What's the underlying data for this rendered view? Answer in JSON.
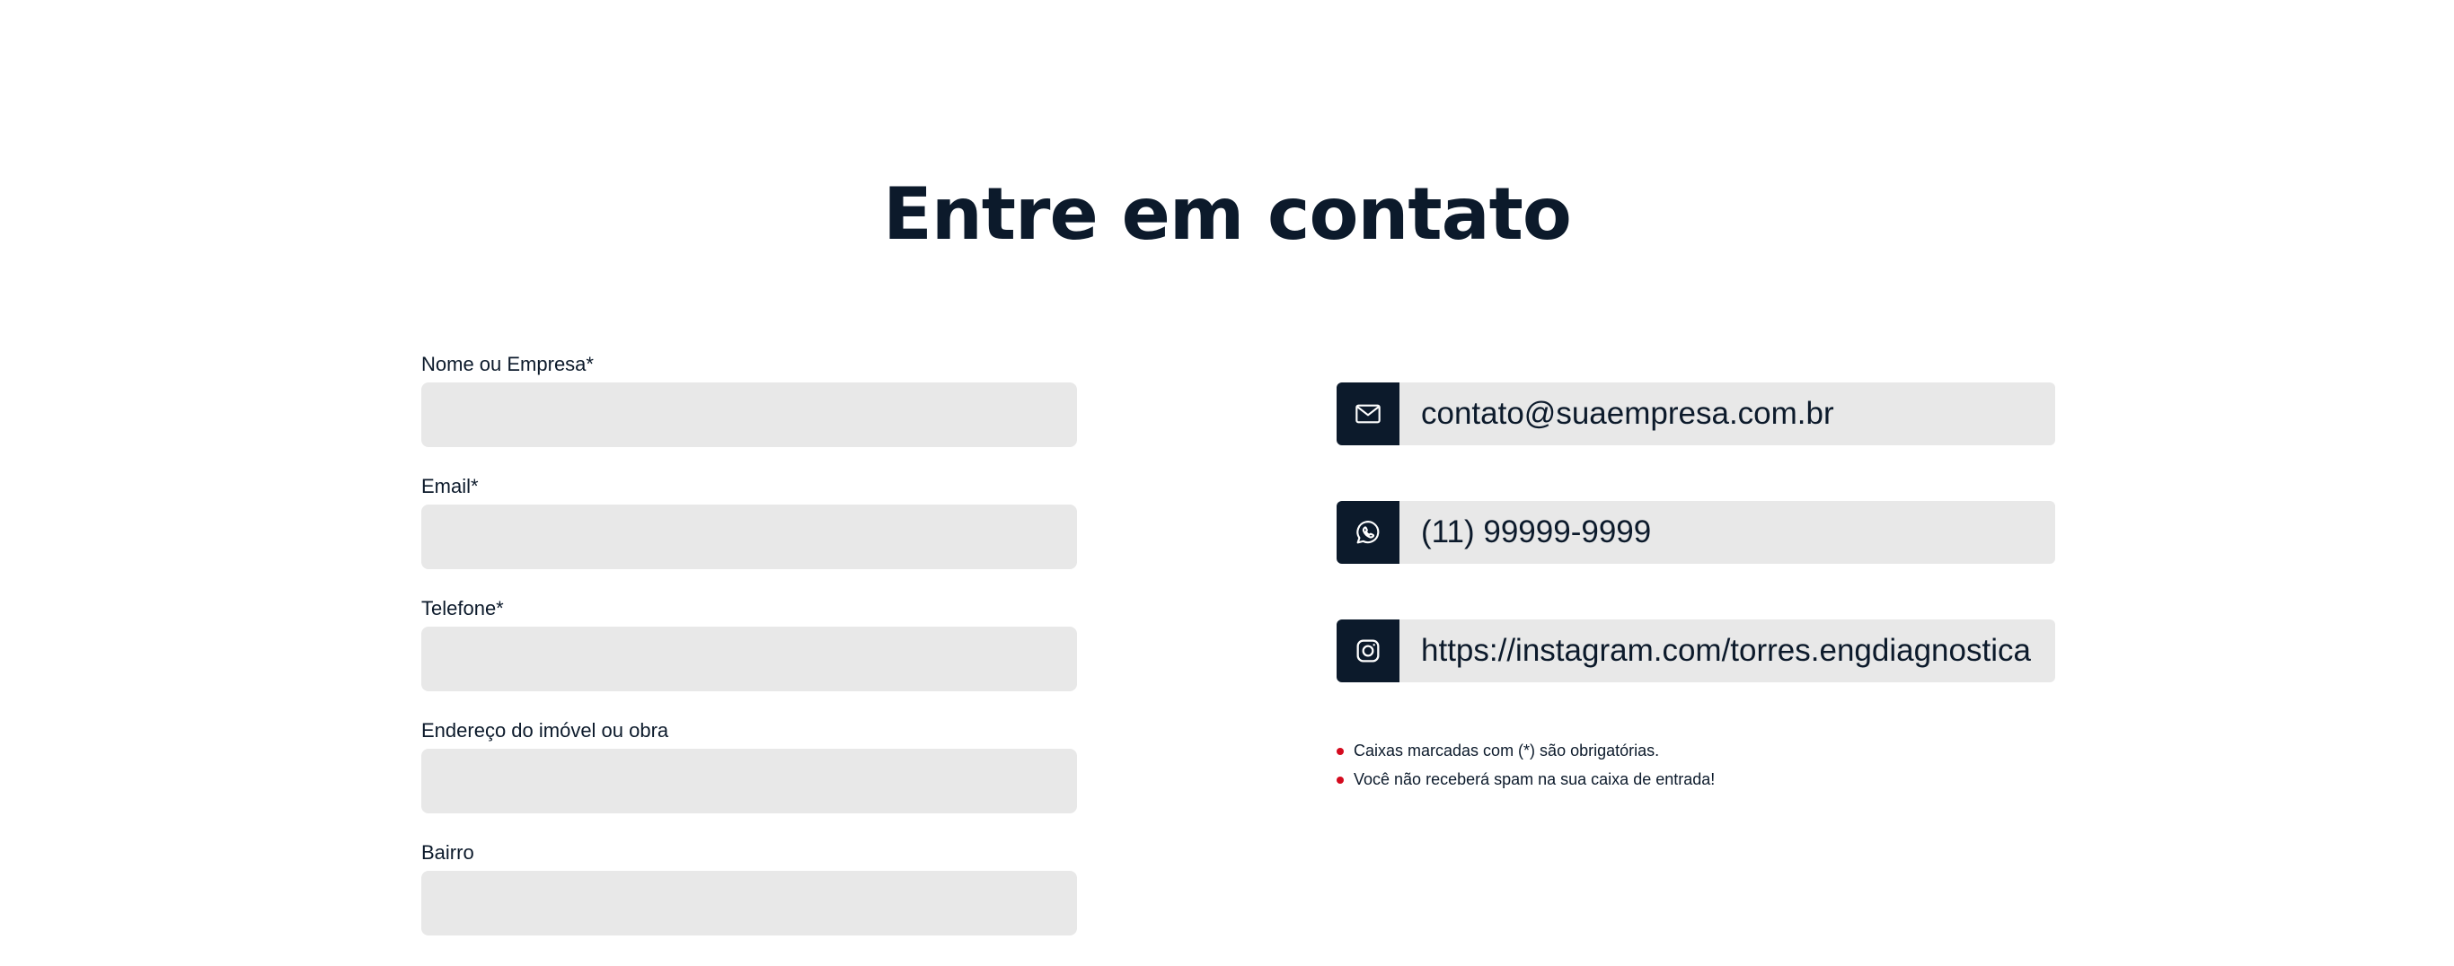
{
  "title": "Entre em contato",
  "form": {
    "fields": [
      {
        "label": "Nome ou Empresa*",
        "value": "",
        "placeholder": ""
      },
      {
        "label": "Email*",
        "value": "",
        "placeholder": ""
      },
      {
        "label": "Telefone*",
        "value": "",
        "placeholder": ""
      },
      {
        "label": "Endereço do imóvel ou obra",
        "value": "",
        "placeholder": ""
      },
      {
        "label": "Bairro",
        "value": "",
        "placeholder": ""
      }
    ]
  },
  "contacts": [
    {
      "icon": "mail-icon",
      "text": "contato@suaempresa.com.br"
    },
    {
      "icon": "whatsapp-icon",
      "text": "(11) 99999-9999"
    },
    {
      "icon": "instagram-icon",
      "text": "https://instagram.com/torres.engdiagnostica"
    }
  ],
  "notes": [
    "Caixas marcadas com (*) são obrigatórias.",
    "Você não receberá spam na sua caixa de entrada!"
  ],
  "colors": {
    "primary": "#0c1a2b",
    "field_bg": "#e8e8e8",
    "bullet": "#d40a1e"
  }
}
